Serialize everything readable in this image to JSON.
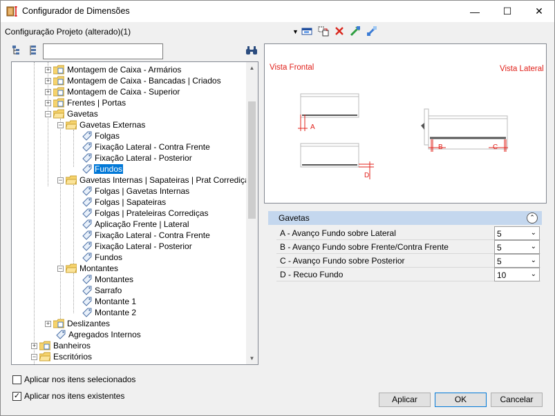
{
  "window": {
    "title": "Configurador de Dimensões",
    "controls": {
      "minimize": "—",
      "maximize": "☐",
      "close": "✕"
    }
  },
  "toolbar": {
    "configuration_label": "Configuração Projeto (alterado)(1)",
    "dropdown_glyph": "▼"
  },
  "search": {
    "value": ""
  },
  "tree": {
    "items": [
      {
        "label": "Montagem de Caixa - Armários"
      },
      {
        "label": "Montagem de Caixa - Bancadas | Criados"
      },
      {
        "label": "Montagem de Caixa - Superior"
      },
      {
        "label": "Frentes | Portas"
      },
      {
        "label": "Gavetas"
      },
      {
        "label": "Gavetas Externas"
      },
      {
        "label": "Folgas"
      },
      {
        "label": "Fixação Lateral - Contra Frente"
      },
      {
        "label": "Fixação Lateral - Posterior"
      },
      {
        "label": "Fundos"
      },
      {
        "label": "Gavetas Internas | Sapateiras | Prat Corrediça"
      },
      {
        "label": "Folgas | Gavetas Internas"
      },
      {
        "label": "Folgas | Sapateiras"
      },
      {
        "label": "Folgas | Prateleiras Corrediças"
      },
      {
        "label": "Aplicação Frente | Lateral"
      },
      {
        "label": "Fixação Lateral - Contra Frente"
      },
      {
        "label": "Fixação Lateral - Posterior"
      },
      {
        "label": "Fundos"
      },
      {
        "label": "Montantes"
      },
      {
        "label": "Montantes"
      },
      {
        "label": "Sarrafo"
      },
      {
        "label": "Montante 1"
      },
      {
        "label": "Montante 2"
      },
      {
        "label": "Deslizantes"
      },
      {
        "label": "Agregados Internos"
      },
      {
        "label": "Banheiros"
      },
      {
        "label": "Escritórios"
      }
    ]
  },
  "preview": {
    "front_label": "Vista Frontal",
    "side_label": "Vista Lateral",
    "dims": {
      "a": "A",
      "b": "B",
      "c": "C",
      "d": "D"
    }
  },
  "properties": {
    "section_title": "Gavetas",
    "collapse_glyph": "⌃",
    "rows": [
      {
        "name": "A - Avanço Fundo sobre Lateral",
        "value": "5"
      },
      {
        "name": "B - Avanço Fundo sobre Frente/Contra Frente",
        "value": "5"
      },
      {
        "name": "C - Avanço Fundo sobre Posterior",
        "value": "5"
      },
      {
        "name": "D - Recuo Fundo",
        "value": "10"
      }
    ]
  },
  "options": {
    "apply_selected": {
      "label": "Aplicar nos itens selecionados",
      "checked": false
    },
    "apply_existing": {
      "label": "Aplicar nos itens existentes",
      "checked": true,
      "mark": "✓"
    }
  },
  "buttons": {
    "apply": "Aplicar",
    "ok": "OK",
    "cancel": "Cancelar"
  },
  "colors": {
    "accent": "#0078d7",
    "dimension": "#e0201a",
    "section_header": "#c4d7ee"
  }
}
